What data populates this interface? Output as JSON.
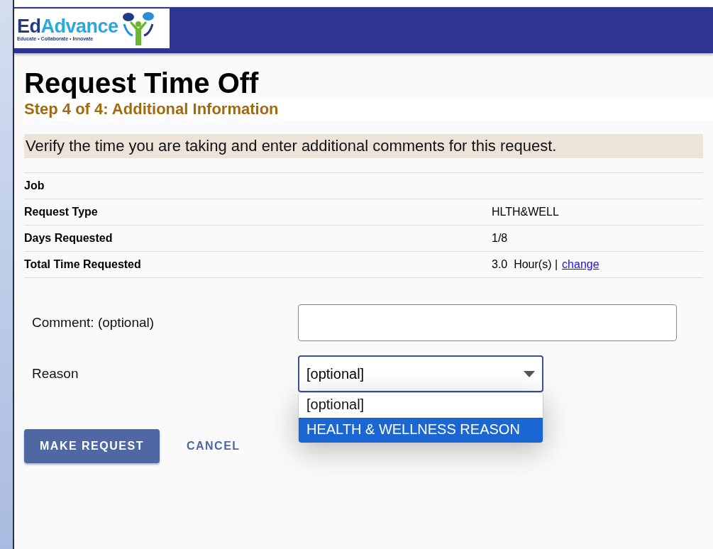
{
  "logo": {
    "name_part_1": "Ed",
    "name_part_2": "Advance",
    "tagline": "Educate • Collaborate • Innovate"
  },
  "title": "Request Time Off",
  "step": "Step 4 of 4: Additional Information",
  "instructions": "Verify the time you are taking and enter additional comments for this request.",
  "summary": [
    {
      "label": "Job"
    },
    {
      "label": "Request Type",
      "value": "HLTH&WELL"
    },
    {
      "label": "Days Requested",
      "value": "1/8"
    },
    {
      "label": "Total Time Requested",
      "value": "3.0  Hour(s) |",
      "link": "change"
    }
  ],
  "comment": {
    "label": "Comment: (optional)"
  },
  "reason": {
    "label": "Reason",
    "value": "[optional]",
    "expanded": true,
    "options": [
      {
        "label": "[optional]",
        "highlighted": false
      },
      {
        "label": "HEALTH & WELLNESS REASON",
        "highlighted": true
      }
    ]
  },
  "buttons": [
    {
      "label": "MAKE REQUEST",
      "kind": "primary"
    },
    {
      "label": "CANCEL",
      "kind": "text"
    }
  ]
}
